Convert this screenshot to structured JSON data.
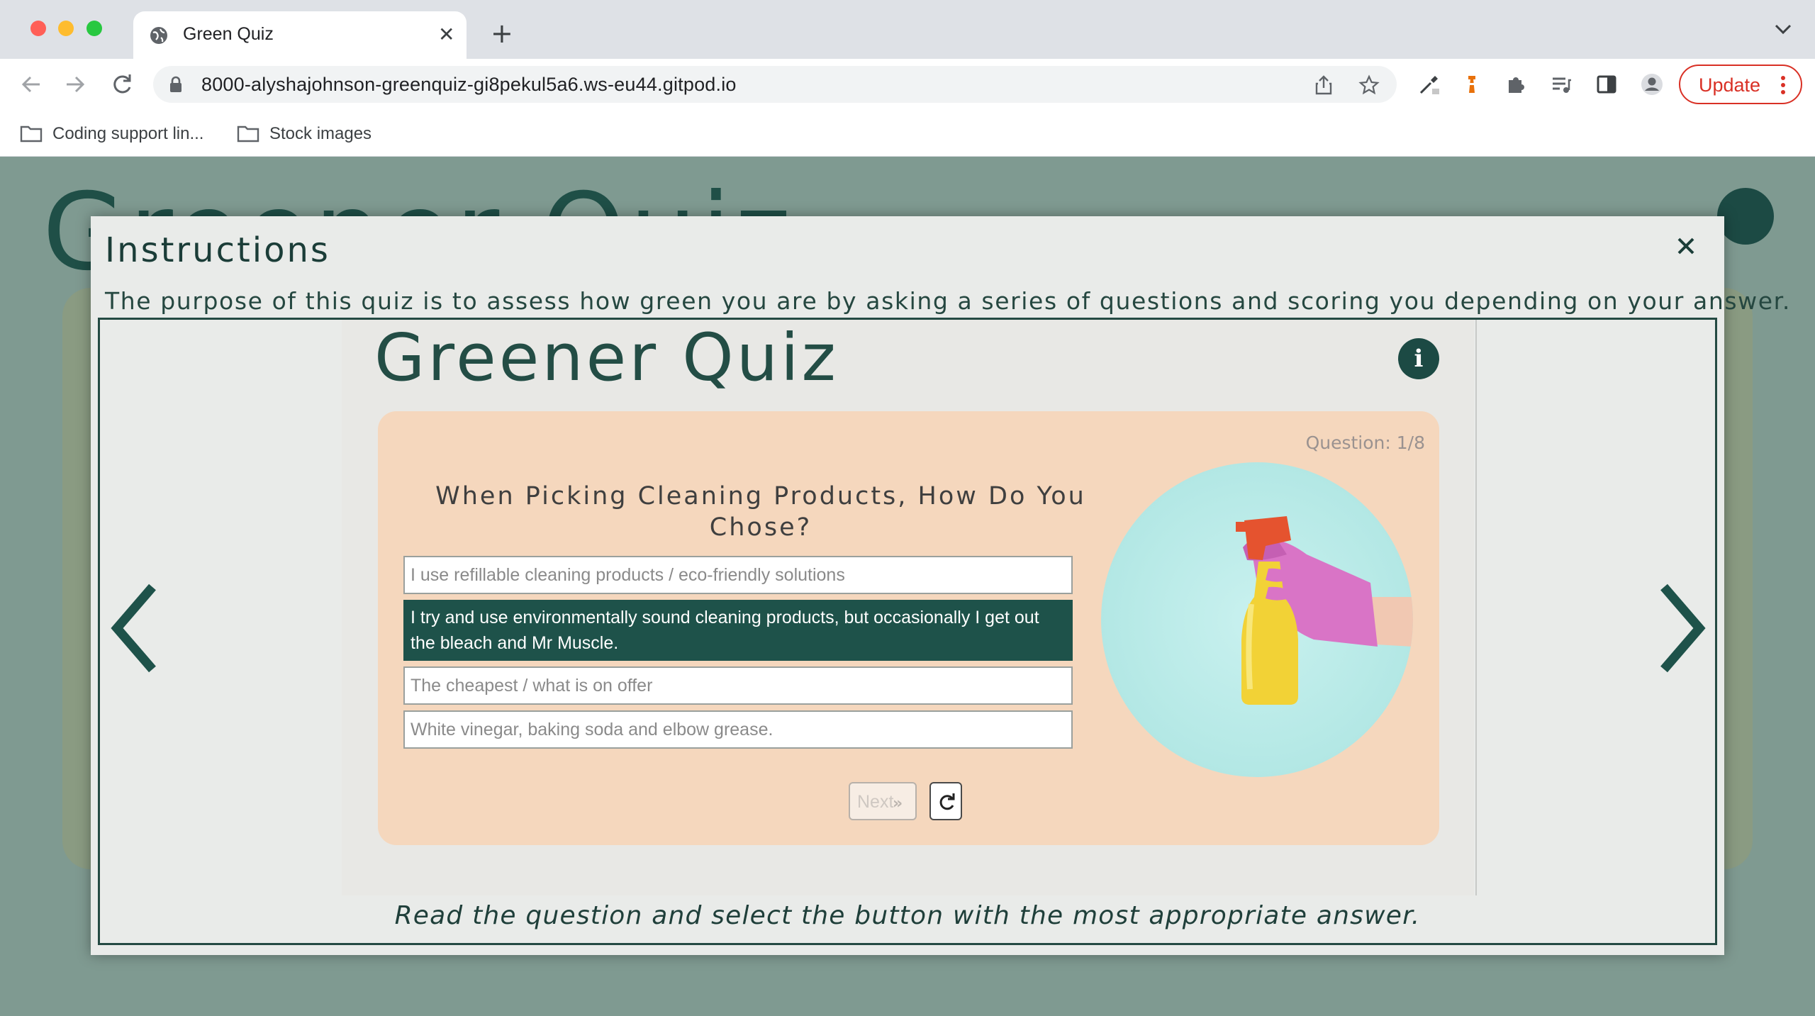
{
  "browser": {
    "tab_title": "Green Quiz",
    "url": "8000-alyshajohnson-greenquiz-gi8pekul5a6.ws-eu44.gitpod.io",
    "update_label": "Update",
    "bookmarks": [
      {
        "label": "Coding support lin...",
        "icon": "folder-icon"
      },
      {
        "label": "Stock images",
        "icon": "folder-icon"
      }
    ]
  },
  "page": {
    "background_title": "Greener Quiz"
  },
  "modal": {
    "title": "Instructions",
    "description": "The purpose of this quiz is to assess how green you are by asking a series of questions and scoring you depending on your answer.",
    "close_icon": "close-icon",
    "caption": "Read the question and select the button with the most appropriate answer."
  },
  "slide": {
    "title": "Greener Quiz",
    "question_count": "Question: 1/8",
    "question": "When Picking Cleaning Products, How Do You Chose?",
    "answers": [
      "I use refillable cleaning products / eco-friendly solutions",
      "I try and use environmentally sound cleaning products, but occasionally I get out the bleach and Mr Muscle.",
      "The cheapest / what is on offer",
      "White vinegar, baking soda and elbow grease."
    ],
    "selected_answer_index": 1,
    "next_label": "Next",
    "image": "spray-bottle-gloved-hand"
  },
  "colors": {
    "accent": "#1e524a",
    "page_bg": "#7f9a91",
    "card_bg": "#f5d7bd",
    "update_red": "#d93025"
  }
}
